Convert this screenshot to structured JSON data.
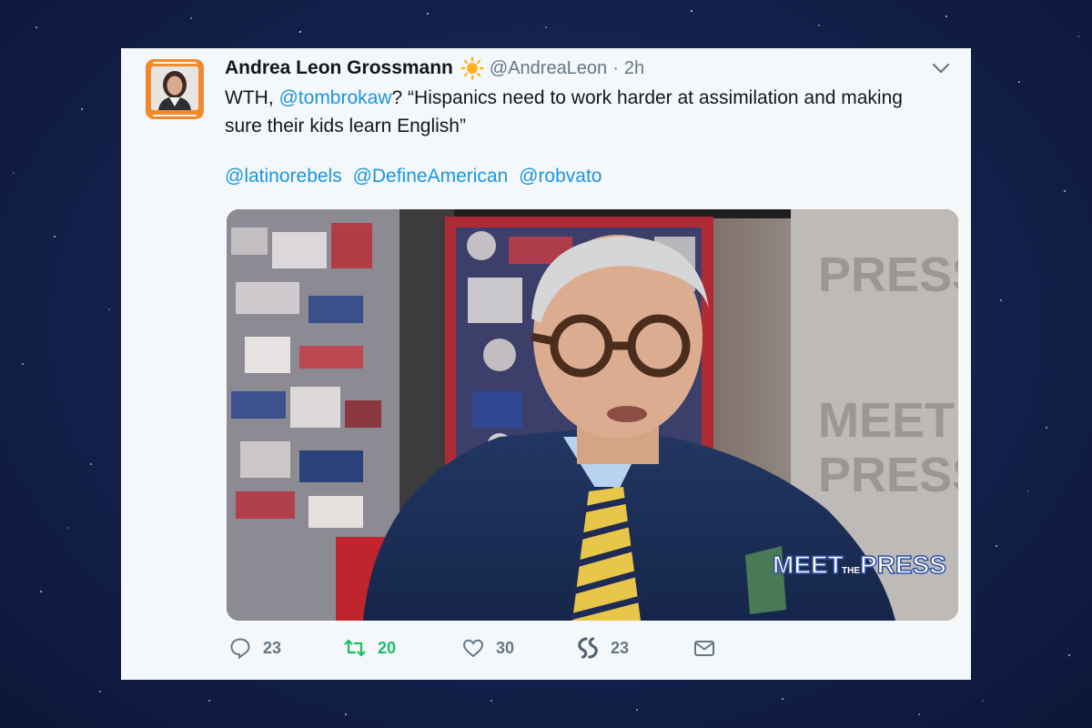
{
  "tweet": {
    "author_name": "Andrea Leon Grossmann",
    "handle": "@AndreaLeon",
    "separator": "·",
    "time": "2h",
    "text_prefix": "WTH, ",
    "mention_main": "@tombrokaw",
    "text_suffix": "? “Hispanics need to work harder at assimilation and making",
    "text_line2": "sure their kids learn English”",
    "mentions": [
      "@latinorebels",
      "@DefineAmerican",
      "@robvato"
    ]
  },
  "media": {
    "overlay_meet": "MEET",
    "overlay_the": "THE",
    "overlay_press": "PRESS",
    "bg_sign_1": "PRESS",
    "bg_sign_2": "MEET",
    "bg_sign_3": "PRESS"
  },
  "actions": {
    "reply_count": "23",
    "retweet_count": "20",
    "like_count": "30",
    "share_count": "23"
  },
  "colors": {
    "link": "#1b95e0",
    "retweet_active": "#17bf63",
    "muted": "#657786"
  },
  "icons": [
    "sun-icon",
    "chevron-down-icon",
    "reply-icon",
    "retweet-icon",
    "like-icon",
    "stumble-share-icon",
    "direct-message-icon"
  ]
}
